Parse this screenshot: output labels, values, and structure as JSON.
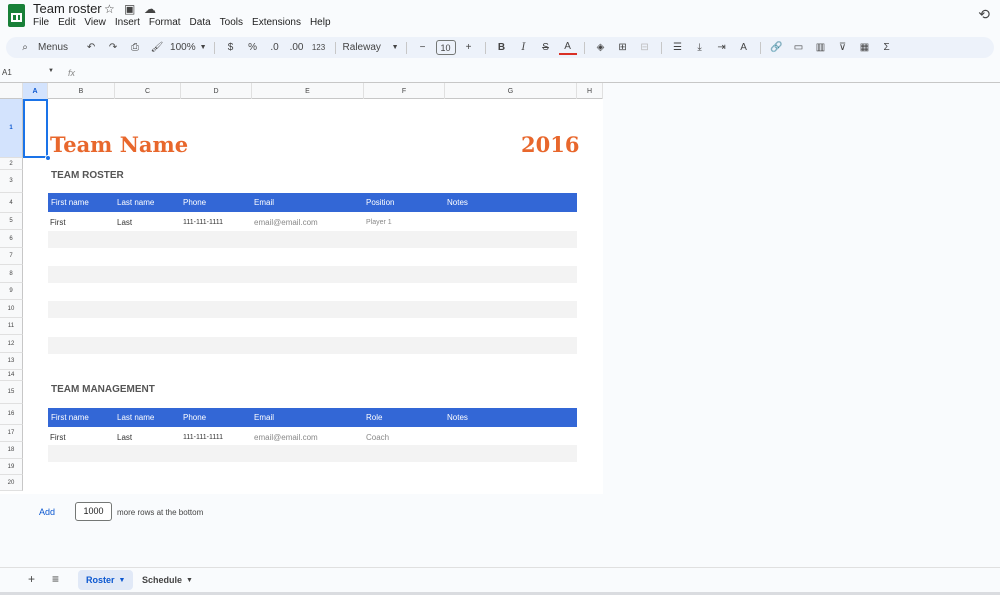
{
  "document": {
    "title": "Team roster",
    "star_icon": "star-icon",
    "move_icon": "folder-icon",
    "cloud_icon": "cloud-icon"
  },
  "menu": [
    "File",
    "Edit",
    "View",
    "Insert",
    "Format",
    "Data",
    "Tools",
    "Extensions",
    "Help"
  ],
  "toolbar": {
    "search_label": "Menus",
    "zoom": "100%",
    "currency": "$",
    "percent": "%",
    "dec_decrease": ".0",
    "dec_increase": ".00",
    "number_format": "123",
    "font": "Raleway",
    "font_size": "10"
  },
  "formula_bar": {
    "cell_ref": "A1",
    "fx": "fx"
  },
  "columns": [
    "A",
    "B",
    "C",
    "D",
    "E",
    "F",
    "G",
    "H"
  ],
  "rows": [
    "1",
    "2",
    "3",
    "4",
    "5",
    "6",
    "7",
    "8",
    "9",
    "10",
    "11",
    "12",
    "13",
    "14",
    "15",
    "16",
    "17",
    "18",
    "19",
    "20"
  ],
  "sheet": {
    "team_name": "Team Name",
    "year": "2016",
    "roster_title": "TEAM ROSTER",
    "roster_headers": [
      "First name",
      "Last name",
      "Phone",
      "Email",
      "Position",
      "Notes"
    ],
    "roster_row": [
      "First",
      "Last",
      "111-111-1111",
      "email@email.com",
      "Player 1",
      ""
    ],
    "mgmt_title": "TEAM MANAGEMENT",
    "mgmt_headers": [
      "First name",
      "Last name",
      "Phone",
      "Email",
      "Role",
      "Notes"
    ],
    "mgmt_row": [
      "First",
      "Last",
      "111-111-1111",
      "email@email.com",
      "Coach",
      ""
    ]
  },
  "add_rows": {
    "button": "Add",
    "count": "1000",
    "suffix": "more rows at the bottom"
  },
  "tabs": {
    "active": "Roster",
    "other": "Schedule"
  },
  "colors": {
    "accent": "#3367d6",
    "title": "#e8672c",
    "selection": "#1a73e8"
  }
}
